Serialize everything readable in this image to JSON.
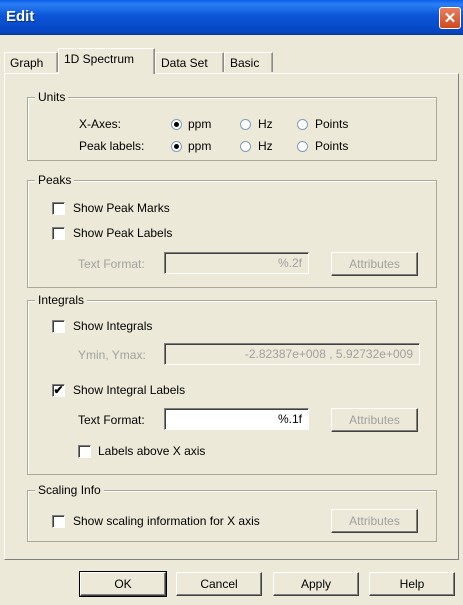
{
  "window": {
    "title": "Edit",
    "close": "✕"
  },
  "tabs": [
    "Graph",
    "1D Spectrum",
    "Data Set",
    "Basic"
  ],
  "units": {
    "title": "Units",
    "x_axes_label": "X-Axes:",
    "peak_labels_label": "Peak labels:",
    "options": [
      "ppm",
      "Hz",
      "Points"
    ],
    "x_axes_selected": "ppm",
    "peak_labels_selected": "ppm"
  },
  "peaks": {
    "title": "Peaks",
    "show_marks": "Show Peak Marks",
    "show_labels": "Show Peak Labels",
    "text_format_label": "Text Format:",
    "text_format_value": "%.2f",
    "attributes": "Attributes"
  },
  "integrals": {
    "title": "Integrals",
    "show_integrals": "Show Integrals",
    "ymin_ymax_label": "Ymin, Ymax:",
    "ymin_ymax_value": "-2.82387e+008 , 5.92732e+009",
    "show_integral_labels": "Show Integral Labels",
    "show_integral_labels_checked": true,
    "text_format_label": "Text Format:",
    "text_format_value": "%.1f",
    "attributes": "Attributes",
    "labels_above": "Labels above X axis"
  },
  "scaling": {
    "title": "Scaling Info",
    "show_scaling": "Show scaling information for X axis",
    "attributes": "Attributes"
  },
  "buttons": {
    "ok": "OK",
    "cancel": "Cancel",
    "apply": "Apply",
    "help": "Help"
  }
}
